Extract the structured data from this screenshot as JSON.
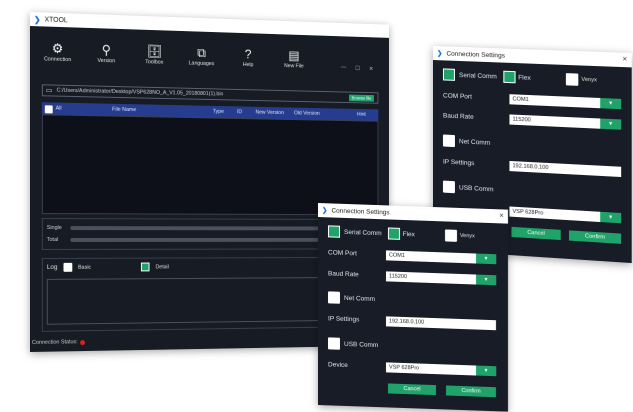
{
  "app": {
    "title": "XTOOL"
  },
  "toolbar": {
    "items": [
      {
        "label": "Connection",
        "icon": "gear-icon",
        "glyph": "⚙"
      },
      {
        "label": "Version",
        "icon": "search-icon",
        "glyph": "⚲"
      },
      {
        "label": "Toolbox",
        "icon": "toolbox-icon",
        "glyph": "🗄"
      },
      {
        "label": "Languages",
        "icon": "languages-icon",
        "glyph": "⧉"
      },
      {
        "label": "Help",
        "icon": "help-icon",
        "glyph": "?"
      },
      {
        "label": "New File",
        "icon": "new-file-icon",
        "glyph": "▤"
      }
    ]
  },
  "path": {
    "value": "C:/Users/Administrator/Desktop/VSP628NO_A_V1.05_20180801(1).bin",
    "browse": "Browse file"
  },
  "table": {
    "headers": [
      "All",
      "File Name",
      "Type",
      "ID",
      "New Version",
      "Old Version",
      "Hint"
    ]
  },
  "progress": {
    "single_label": "Single",
    "total_label": "Total"
  },
  "log": {
    "label": "Log",
    "basic": "Basic",
    "detail": "Detail"
  },
  "status": {
    "label": "Connection Status:"
  },
  "dialog": {
    "title": "Connection Settings",
    "serial_comm": "Serial Comm",
    "flex": "Flex",
    "venyx": "Venyx",
    "com_port_label": "COM Port",
    "com_port_value": "COM1",
    "baud_rate_label": "Baud Rate",
    "baud_rate_value": "115200",
    "net_comm": "Net Comm",
    "ip_settings_label": "IP Settings",
    "ip_value": "192.168.0.100",
    "usb_comm": "USB Comm",
    "device_label": "Device",
    "device_value": "VSP 628Pro",
    "cancel": "Cancel",
    "confirm": "Confirm"
  }
}
